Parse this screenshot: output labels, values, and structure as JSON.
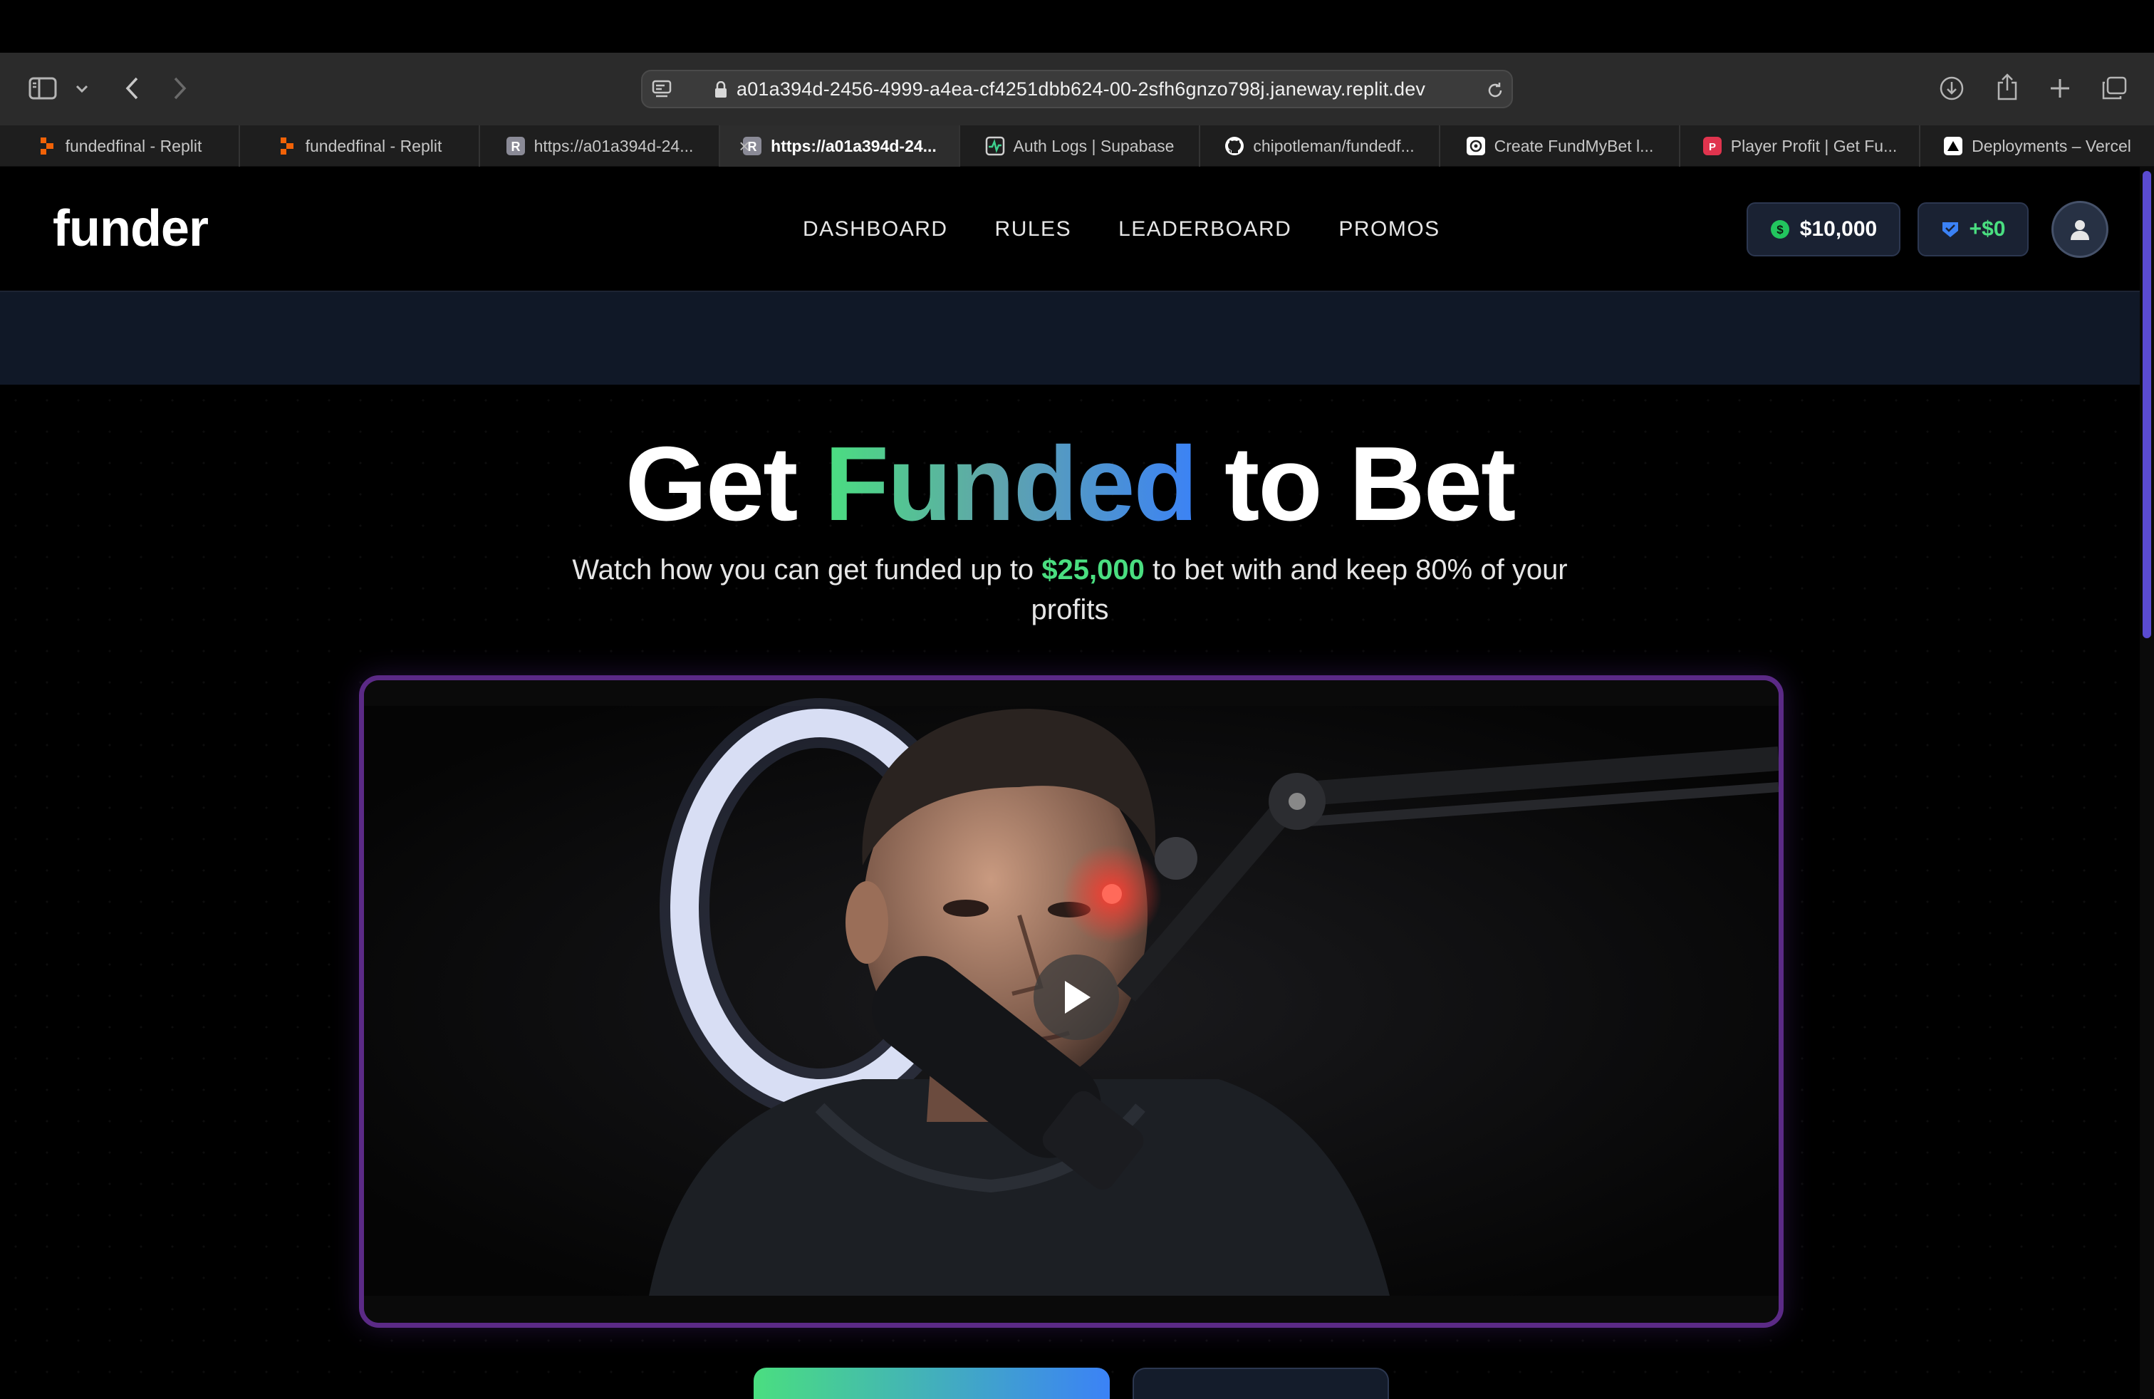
{
  "browser": {
    "url": "a01a394d-2456-4999-a4ea-cf4251dbb624-00-2sfh6gnzo798j.janeway.replit.dev",
    "tabs": [
      {
        "label": "fundedfinal - Replit",
        "icon": "replit-icon",
        "active": false
      },
      {
        "label": "fundedfinal - Replit",
        "icon": "replit-icon",
        "active": false
      },
      {
        "label": "https://a01a394d-24...",
        "icon": "r-icon",
        "active": false
      },
      {
        "label": "https://a01a394d-24...",
        "icon": "r-icon",
        "active": true
      },
      {
        "label": "Auth Logs | Supabase",
        "icon": "supabase-icon",
        "active": false
      },
      {
        "label": "chipotleman/fundedf...",
        "icon": "github-icon",
        "active": false
      },
      {
        "label": "Create FundMyBet l...",
        "icon": "openai-icon",
        "active": false
      },
      {
        "label": "Player Profit | Get Fu...",
        "icon": "player-profit-icon",
        "active": false
      },
      {
        "label": "Deployments – Vercel",
        "icon": "vercel-icon",
        "active": false
      }
    ]
  },
  "app": {
    "logo": "funder",
    "nav": [
      "DASHBOARD",
      "RULES",
      "LEADERBOARD",
      "PROMOS"
    ],
    "balance": "$10,000",
    "profit": "+$0"
  },
  "hero": {
    "title_part1": "Get",
    "title_highlight": "Funded",
    "title_part2": "to Bet",
    "subtitle_pre": "Watch how you can get funded up to",
    "subtitle_amount": "$25,000",
    "subtitle_post": "to bet with and keep 80% of your profits"
  },
  "colors": {
    "accent_green": "#4ade80",
    "accent_blue": "#3b82f6",
    "video_border": "#5b2a86",
    "banner": "#101827"
  }
}
